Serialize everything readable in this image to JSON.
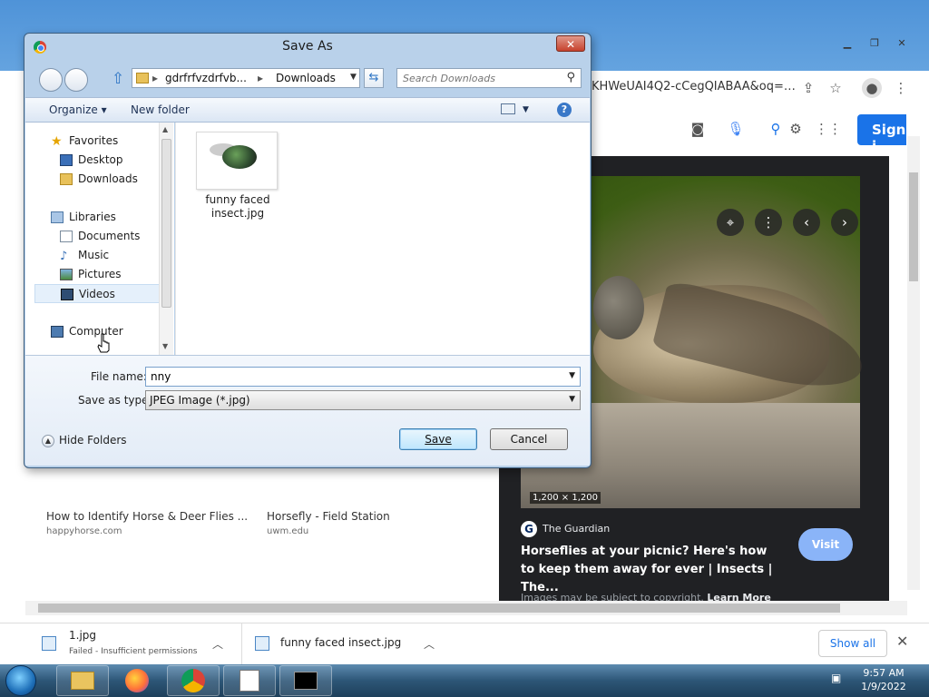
{
  "colors": {
    "chrome_blue": "#1a73e8",
    "visit_button": "#8ab4f8",
    "dialog_frame": "#b9d1ea",
    "preview_bg": "#202124",
    "taskbar": "#2d5677"
  },
  "browser": {
    "address_tail": "KHWeUAI4Q2-cCegQIABAA&oq=…",
    "sign_in_label": "Sign i",
    "preview": {
      "dimensions": "1,200 × 1,200",
      "source_logo": "G",
      "source_name": "The Guardian",
      "title": "Horseflies at your picnic? Here's how to keep them away for ever | Insects | The...",
      "visit_label": "Visit",
      "copyright": "Images may be subject to copyright.",
      "learn_more": "Learn More"
    },
    "results": [
      {
        "caption": "How to Identify Horse & Deer Flies ...",
        "domain": "happyhorse.com"
      },
      {
        "caption": "Horsefly - Field Station",
        "domain": "uwm.edu"
      }
    ]
  },
  "downloads": {
    "items": [
      {
        "name": "1.jpg",
        "status": "Failed - Insufficient permissions"
      },
      {
        "name": "funny faced insect.jpg",
        "status": ""
      }
    ],
    "show_all_label": "Show all",
    "close_glyph": "✕"
  },
  "taskbar": {
    "time": "9:57 AM",
    "date": "1/9/2022"
  },
  "dialog": {
    "title": "Save As",
    "close_glyph": "✕",
    "address_segments": [
      "gdrfrfvzdrfvb...",
      "Downloads"
    ],
    "search_placeholder": "Search Downloads",
    "toolbar": {
      "organize_label": "Organize",
      "new_folder_label": "New folder",
      "help_glyph": "?"
    },
    "nav": {
      "favorites_label": "Favorites",
      "desktop_label": "Desktop",
      "downloads_label": "Downloads",
      "libraries_label": "Libraries",
      "documents_label": "Documents",
      "music_label": "Music",
      "pictures_label": "Pictures",
      "videos_label": "Videos",
      "computer_label": "Computer"
    },
    "file": {
      "name": "funny faced insect.jpg"
    },
    "file_name_label": "File name:",
    "file_name_value": "nny",
    "save_type_label": "Save as type:",
    "save_type_value": "JPEG Image (*.jpg)",
    "hide_folders_label": "Hide Folders",
    "save_label": "Save",
    "cancel_label": "Cancel"
  }
}
